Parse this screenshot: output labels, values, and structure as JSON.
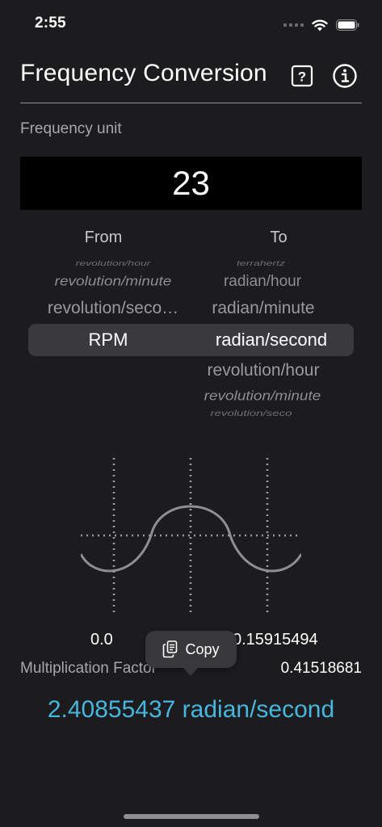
{
  "status_bar": {
    "time": "2:55"
  },
  "header": {
    "title": "Frequency Conversion",
    "help_icon": "question-square-icon",
    "info_icon": "info-circle-icon"
  },
  "unit_label": "Frequency unit",
  "input": {
    "value": "23"
  },
  "picker": {
    "from_label": "From",
    "to_label": "To",
    "from_items": [
      "revolution/hour",
      "revolution/minute",
      "revolution/seco…",
      "RPM"
    ],
    "from_selected": "RPM",
    "to_items": [
      "terrahertz",
      "radian/hour",
      "radian/minute",
      "radian/second",
      "revolution/hour",
      "revolution/minute",
      "revolution/seco"
    ],
    "to_selected": "radian/second"
  },
  "chart": {
    "left_value": "0.0",
    "right_value": "0.15915494"
  },
  "factor": {
    "label": "Multiplication Factor",
    "value": "0.41518681"
  },
  "copy_popup": {
    "label": "Copy",
    "icon": "copy-icon"
  },
  "result": "2.40855437 radian/second",
  "colors": {
    "background": "#1c1c1e",
    "accent": "#46b6de",
    "input_bg": "#000000"
  }
}
